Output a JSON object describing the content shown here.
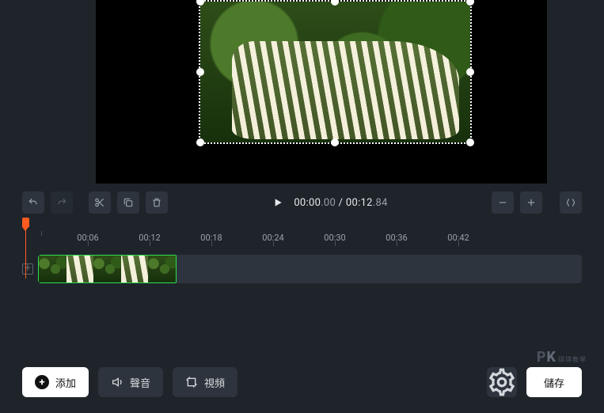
{
  "preview": {
    "selection_handles": [
      "nw",
      "n",
      "ne",
      "w",
      "e",
      "sw",
      "s",
      "se"
    ]
  },
  "toolbar": {
    "undo": "undo-icon",
    "redo": "redo-icon",
    "cut": "scissors-icon",
    "duplicate": "duplicate-icon",
    "delete": "trash-icon",
    "zoom_out": "minus-icon",
    "zoom_in": "plus-icon",
    "fit": "fit-icon"
  },
  "playback": {
    "state": "paused",
    "current": "00:00",
    "current_frac": ".00",
    "sep": " / ",
    "total": "00:12",
    "total_frac": ".84"
  },
  "ruler": {
    "ticks": [
      "",
      "00:06",
      "00:12",
      "00:18",
      "00:24",
      "00:30",
      "00:36",
      "00:42"
    ]
  },
  "timeline": {
    "playhead_seconds": 0,
    "clip": {
      "start": 0,
      "thumbs": 5
    }
  },
  "bottom": {
    "add_label": "添加",
    "audio_label": "聲音",
    "video_label": "視頻",
    "settings": "gear-icon",
    "save_label": "儲存"
  },
  "watermark": {
    "brand_p": "P",
    "brand_k": "K",
    "sub": "琪琪教學"
  }
}
